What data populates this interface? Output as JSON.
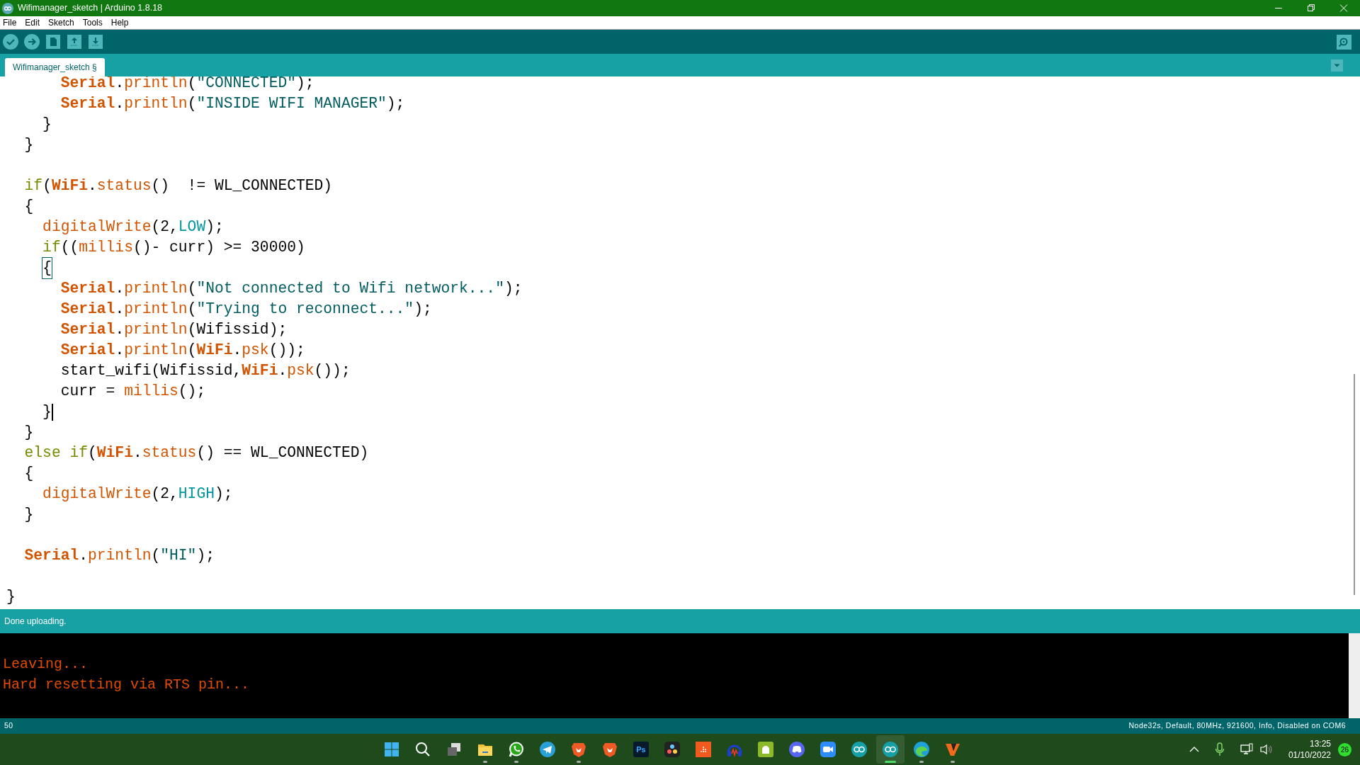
{
  "window": {
    "title": "Wifimanager_sketch | Arduino 1.8.18"
  },
  "menu": [
    "File",
    "Edit",
    "Sketch",
    "Tools",
    "Help"
  ],
  "toolbar": [
    {
      "kind": "verify"
    },
    {
      "kind": "upload"
    },
    {
      "kind": "new"
    },
    {
      "kind": "open"
    },
    {
      "kind": "save"
    }
  ],
  "tabs": [
    {
      "label": "Wifimanager_sketch §",
      "selected": true
    }
  ],
  "editor": {
    "lines": [
      {
        "tokens": [
          {
            "kind": "keyword",
            "text": "      Serial"
          },
          {
            "kind": "plain",
            "text": "."
          },
          {
            "kind": "function",
            "text": "println"
          },
          {
            "kind": "plain",
            "text": "("
          },
          {
            "kind": "string",
            "text": "\"CONNECTED\""
          },
          {
            "kind": "plain",
            "text": ");"
          }
        ]
      },
      {
        "tokens": [
          {
            "kind": "keyword",
            "text": "      Serial"
          },
          {
            "kind": "plain",
            "text": "."
          },
          {
            "kind": "function",
            "text": "println"
          },
          {
            "kind": "plain",
            "text": "("
          },
          {
            "kind": "string",
            "text": "\"INSIDE WIFI MANAGER\""
          },
          {
            "kind": "plain",
            "text": ");"
          }
        ]
      },
      {
        "tokens": [
          {
            "kind": "plain",
            "text": "    }"
          }
        ]
      },
      {
        "tokens": [
          {
            "kind": "plain",
            "text": "  }"
          }
        ]
      },
      {
        "blank": true
      },
      {
        "tokens": [
          {
            "kind": "control",
            "text": "  if"
          },
          {
            "kind": "plain",
            "text": "("
          },
          {
            "kind": "keyword",
            "text": "WiFi"
          },
          {
            "kind": "plain",
            "text": "."
          },
          {
            "kind": "function",
            "text": "status"
          },
          {
            "kind": "plain",
            "text": "()  != WL_CONNECTED)"
          }
        ]
      },
      {
        "tokens": [
          {
            "kind": "plain",
            "text": "  {"
          }
        ]
      },
      {
        "tokens": [
          {
            "kind": "function",
            "text": "    digitalWrite"
          },
          {
            "kind": "plain",
            "text": "(2,"
          },
          {
            "kind": "constant",
            "text": "LOW"
          },
          {
            "kind": "plain",
            "text": ");"
          }
        ]
      },
      {
        "tokens": [
          {
            "kind": "control",
            "text": "    if"
          },
          {
            "kind": "plain",
            "text": "(("
          },
          {
            "kind": "function",
            "text": "millis"
          },
          {
            "kind": "plain",
            "text": "()- curr) >= 30000)"
          }
        ]
      },
      {
        "tokens": [
          {
            "kind": "bracket",
            "text": "    {"
          }
        ]
      },
      {
        "tokens": [
          {
            "kind": "keyword",
            "text": "      Serial"
          },
          {
            "kind": "plain",
            "text": "."
          },
          {
            "kind": "function",
            "text": "println"
          },
          {
            "kind": "plain",
            "text": "("
          },
          {
            "kind": "string",
            "text": "\"Not connected to Wifi network...\""
          },
          {
            "kind": "plain",
            "text": ");"
          }
        ]
      },
      {
        "tokens": [
          {
            "kind": "keyword",
            "text": "      Serial"
          },
          {
            "kind": "plain",
            "text": "."
          },
          {
            "kind": "function",
            "text": "println"
          },
          {
            "kind": "plain",
            "text": "("
          },
          {
            "kind": "string",
            "text": "\"Trying to reconnect...\""
          },
          {
            "kind": "plain",
            "text": ");"
          }
        ]
      },
      {
        "tokens": [
          {
            "kind": "keyword",
            "text": "      Serial"
          },
          {
            "kind": "plain",
            "text": "."
          },
          {
            "kind": "function",
            "text": "println"
          },
          {
            "kind": "plain",
            "text": "(Wifissid);"
          }
        ]
      },
      {
        "tokens": [
          {
            "kind": "keyword",
            "text": "      Serial"
          },
          {
            "kind": "plain",
            "text": "."
          },
          {
            "kind": "function",
            "text": "println"
          },
          {
            "kind": "plain",
            "text": "("
          },
          {
            "kind": "keyword",
            "text": "WiFi"
          },
          {
            "kind": "plain",
            "text": "."
          },
          {
            "kind": "function",
            "text": "psk"
          },
          {
            "kind": "plain",
            "text": "());"
          }
        ]
      },
      {
        "tokens": [
          {
            "kind": "plain",
            "text": "      start_wifi(Wifissid,"
          },
          {
            "kind": "keyword",
            "text": "WiFi"
          },
          {
            "kind": "plain",
            "text": "."
          },
          {
            "kind": "function",
            "text": "psk"
          },
          {
            "kind": "plain",
            "text": "());"
          }
        ]
      },
      {
        "tokens": [
          {
            "kind": "plain",
            "text": "      curr = "
          },
          {
            "kind": "function",
            "text": "millis"
          },
          {
            "kind": "plain",
            "text": "();"
          }
        ]
      },
      {
        "tokens": [
          {
            "kind": "plain",
            "text": "    }"
          }
        ],
        "cursor": true
      },
      {
        "tokens": [
          {
            "kind": "plain",
            "text": "  }"
          }
        ]
      },
      {
        "tokens": [
          {
            "kind": "control",
            "text": "  else if"
          },
          {
            "kind": "plain",
            "text": "("
          },
          {
            "kind": "keyword",
            "text": "WiFi"
          },
          {
            "kind": "plain",
            "text": "."
          },
          {
            "kind": "function",
            "text": "status"
          },
          {
            "kind": "plain",
            "text": "() == WL_CONNECTED)"
          }
        ]
      },
      {
        "tokens": [
          {
            "kind": "plain",
            "text": "  {"
          }
        ]
      },
      {
        "tokens": [
          {
            "kind": "function",
            "text": "    digitalWrite"
          },
          {
            "kind": "plain",
            "text": "(2,"
          },
          {
            "kind": "constant",
            "text": "HIGH"
          },
          {
            "kind": "plain",
            "text": ");"
          }
        ]
      },
      {
        "tokens": [
          {
            "kind": "plain",
            "text": "  }"
          }
        ]
      },
      {
        "blank": true
      },
      {
        "tokens": [
          {
            "kind": "keyword",
            "text": "  Serial"
          },
          {
            "kind": "plain",
            "text": "."
          },
          {
            "kind": "function",
            "text": "println"
          },
          {
            "kind": "plain",
            "text": "("
          },
          {
            "kind": "string",
            "text": "\"HI\""
          },
          {
            "kind": "plain",
            "text": ");"
          }
        ]
      },
      {
        "blank": true
      },
      {
        "tokens": [
          {
            "kind": "plain",
            "text": "}"
          }
        ]
      }
    ]
  },
  "message": "Done uploading.",
  "console": [
    "Leaving...",
    "Hard resetting via RTS pin..."
  ],
  "status_bar": {
    "line": "50",
    "board": "Node32s, Default, 80MHz, 921600, Info, Disabled on COM6"
  },
  "taskbar": {
    "apps": [
      {
        "kind": "start",
        "running": false,
        "selected": false
      },
      {
        "kind": "search",
        "running": false,
        "selected": false
      },
      {
        "kind": "taskview",
        "running": false,
        "selected": false
      },
      {
        "kind": "folder",
        "running": true,
        "selected": false
      },
      {
        "kind": "chat",
        "running": true,
        "selected": false
      },
      {
        "kind": "plane",
        "running": false,
        "selected": false
      },
      {
        "kind": "lion",
        "running": true,
        "selected": false
      },
      {
        "kind": "lion",
        "running": false,
        "selected": false
      },
      {
        "kind": "ps",
        "label": "Ps",
        "running": false,
        "selected": false
      },
      {
        "kind": "resolve",
        "running": false,
        "selected": false
      },
      {
        "kind": "grid",
        "running": false,
        "selected": false
      },
      {
        "kind": "headphones",
        "running": false,
        "selected": false
      },
      {
        "kind": "android",
        "running": false,
        "selected": false
      },
      {
        "kind": "discord",
        "running": false,
        "selected": false
      },
      {
        "kind": "camera",
        "running": false,
        "selected": false
      },
      {
        "kind": "infinity",
        "running": false,
        "selected": false
      },
      {
        "kind": "infinity",
        "running": true,
        "selected": true
      },
      {
        "kind": "edge",
        "running": true,
        "selected": false
      },
      {
        "kind": "vector",
        "running": true,
        "selected": false
      }
    ],
    "time": "13:25",
    "date": "01/10/2022",
    "badge": "26"
  }
}
